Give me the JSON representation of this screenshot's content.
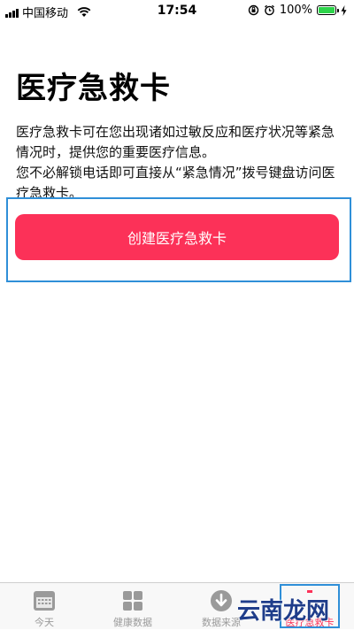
{
  "status_bar": {
    "carrier": "中国移动",
    "time": "17:54",
    "battery_percent": "100%",
    "battery_level": 1.0
  },
  "page": {
    "title": "医疗急救卡",
    "description_1": "医疗急救卡可在您出现诸如过敏反应和医疗状况等紧急情况时，提供您的重要医疗信息。",
    "description_2": "您不必解锁电话即可直接从“紧急情况”拨号键盘访问医疗急救卡。",
    "create_button_label": "创建医疗急救卡"
  },
  "tab_bar": {
    "tabs": [
      {
        "label": "今天",
        "icon": "calendar-icon"
      },
      {
        "label": "健康数据",
        "icon": "grid-icon"
      },
      {
        "label": "数据来源",
        "icon": "download-icon"
      },
      {
        "label": "医疗急救卡",
        "icon": "medical-id-icon"
      }
    ],
    "active_index": 3
  },
  "watermark": "云南龙网",
  "colors": {
    "accent": "#fc3158",
    "highlight_border": "#2f8fd8",
    "battery": "#2dd34a"
  }
}
